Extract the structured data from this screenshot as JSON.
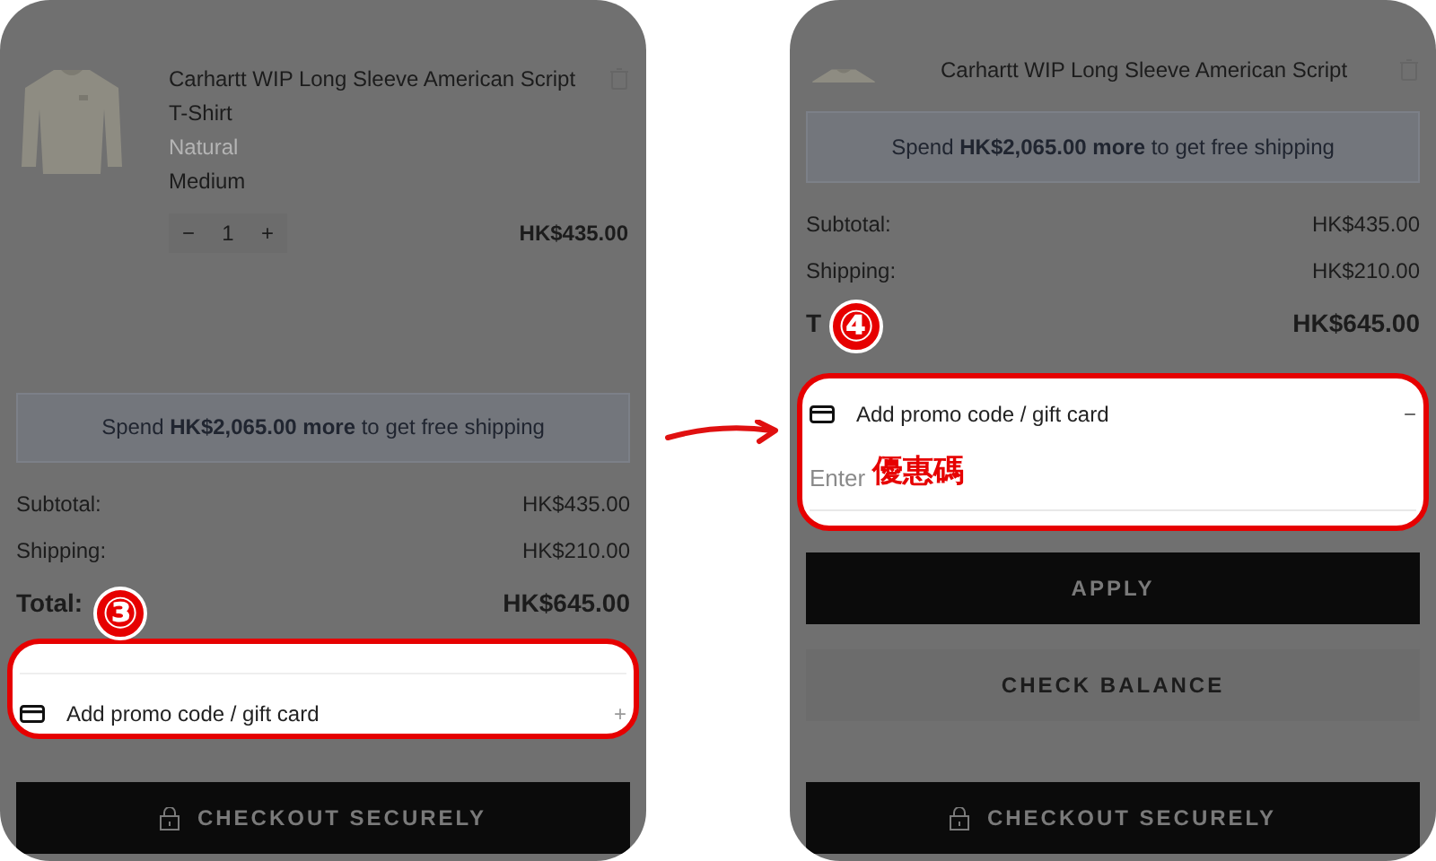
{
  "panels": [
    {
      "step": "③",
      "product": {
        "title": [
          "Carhartt WIP Long Sleeve American Script",
          "T-Shirt"
        ],
        "variant": "Natural",
        "size": "Medium",
        "quantity": "1",
        "minus": "−",
        "plus": "+",
        "price": "HK$435.00"
      },
      "shipping_banner": "Spend **HK$2,065.00 more** to get free shipping",
      "summary": [
        {
          "label": "Subtotal:",
          "value": "HK$435.00",
          "kind": "line"
        },
        {
          "label": "Shipping:",
          "value": "HK$210.00",
          "kind": "line"
        },
        {
          "label": "Total:",
          "value": "HK$645.00",
          "kind": "total"
        }
      ],
      "promo": {
        "label": "Add promo code / gift card",
        "expanded": false,
        "toggle": "+"
      },
      "buttons": [
        {
          "label": "CHECKOUT SECURELY",
          "kind": "checkout"
        }
      ]
    },
    {
      "step": "④",
      "product": {
        "title": [
          "Carhartt WIP Long Sleeve American Script"
        ]
      },
      "shipping_banner": "Spend **HK$2,065.00 more** to get free shipping",
      "summary": [
        {
          "label": "Subtotal:",
          "value": "HK$435.00",
          "kind": "line"
        },
        {
          "label": "Shipping:",
          "value": "HK$210.00",
          "kind": "line"
        },
        {
          "label": "T",
          "value": "HK$645.00",
          "kind": "total"
        }
      ],
      "promo": {
        "label": "Add promo code / gift card",
        "expanded": true,
        "toggle": "−",
        "placeholder": "Enter",
        "annotation": "優惠碼"
      },
      "buttons": [
        {
          "label": "APPLY",
          "kind": "primary"
        },
        {
          "label": "CHECK BALANCE",
          "kind": "secondary"
        },
        {
          "label": "CHECKOUT SECURELY",
          "kind": "checkout"
        }
      ]
    }
  ]
}
